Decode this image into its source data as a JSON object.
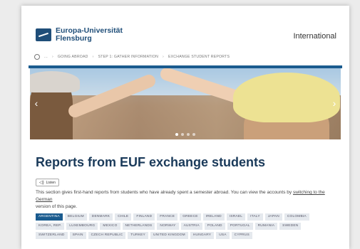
{
  "header": {
    "logo_line1": "Europa-Universität",
    "logo_line2": "Flensburg",
    "language_link": "International"
  },
  "breadcrumb": {
    "items": [
      "...",
      "GOING ABROAD",
      "STEP 1: GATHER INFORMATION",
      "EXCHANGE STUDENT REPORTS"
    ]
  },
  "hero": {
    "slides": 4,
    "active_slide": 1
  },
  "main": {
    "title": "Reports from EUF exchange students",
    "listen_label": "Listen",
    "intro_text": "This section gives first-hand reports from students who have already spent a semester abroad. You can view the accounts by ",
    "intro_link": "switching to the German",
    "intro_end": "version of this page."
  },
  "countries": {
    "active": "ARGENTINA",
    "items": [
      "ARGENTINA",
      "BELGIUM",
      "DENMARK",
      "CHILE",
      "FINLAND",
      "FRANCE",
      "GREECE",
      "IRELAND",
      "ISRAEL",
      "ITALY",
      "JAPAN",
      "COLOMBIA",
      "KOREA, REP.",
      "LUXEMBOURG",
      "MEXICO",
      "NETHERLANDS",
      "NORWAY",
      "AUSTRIA",
      "POLAND",
      "PORTUGAL",
      "RUMANIA",
      "SWEDEN",
      "SWITZERLAND",
      "SPAIN",
      "CZECH REPUBLIC",
      "TURKEY",
      "UNITED KINGDOM",
      "HUNGARY",
      "USA",
      "CYPRUS"
    ]
  },
  "colors": {
    "accent": "#1a5b8f",
    "title": "#1a3a5a"
  }
}
